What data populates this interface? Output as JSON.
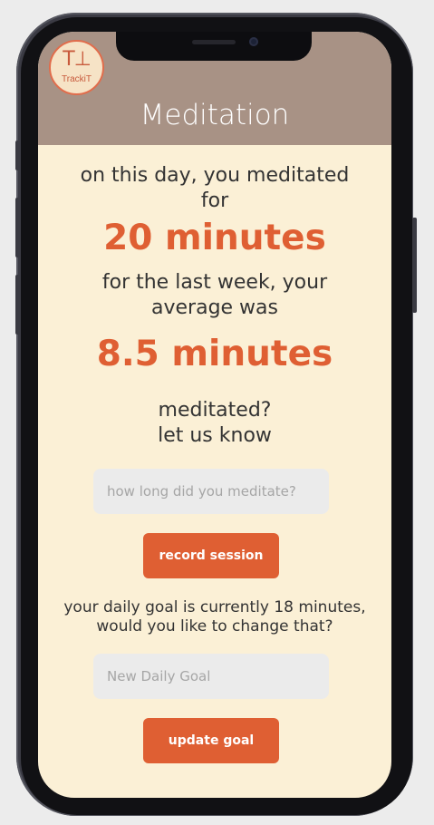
{
  "app": {
    "logo_mark": "T⊥",
    "logo_text": "TrackiT"
  },
  "header": {
    "title": "Meditation"
  },
  "today": {
    "line1": "on this day, you meditated",
    "line2": "for",
    "value": "20 minutes"
  },
  "week": {
    "line1": "for the last week, your",
    "line2": "average was",
    "value": "8.5 minutes"
  },
  "prompt": {
    "line1": "meditated?",
    "line2": "let us know"
  },
  "session_input": {
    "value": "",
    "placeholder": "how long did you meditate?"
  },
  "record_button": {
    "label": "record session"
  },
  "goal": {
    "line1": "your daily goal is currently 18 minutes,",
    "line2": "would you like to change that?"
  },
  "goal_input": {
    "value": "",
    "placeholder": "New Daily Goal"
  },
  "update_button": {
    "label": "update goal"
  },
  "colors": {
    "header_bg": "#a89285",
    "screen_bg": "#fbf0d6",
    "accent": "#df5f33",
    "input_bg": "#ebebeb"
  }
}
